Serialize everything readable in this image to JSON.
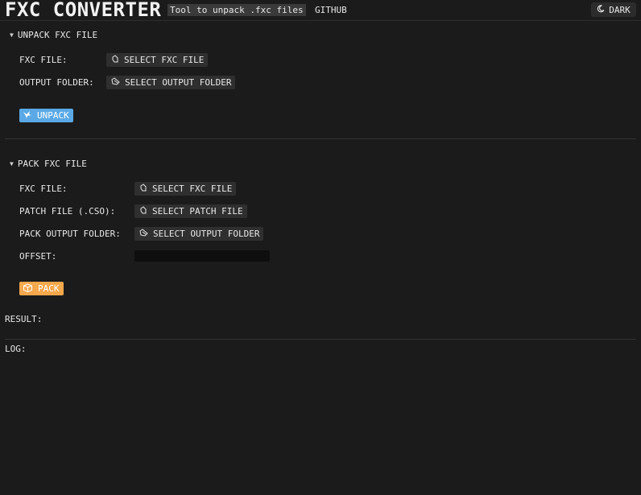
{
  "header": {
    "title": "FXC CONVERTER",
    "subtitle": "Tool to unpack .fxc files",
    "github_label": "GITHUB",
    "theme_label": "DARK"
  },
  "unpack_section": {
    "title": "UNPACK FXC FILE",
    "fxc_label": "FXC FILE:",
    "fxc_button": "SELECT FXC FILE",
    "output_label": "OUTPUT FOLDER:",
    "output_button": "SELECT OUTPUT FOLDER",
    "action_label": "UNPACK"
  },
  "pack_section": {
    "title": "PACK FXC FILE",
    "fxc_label": "FXC FILE:",
    "fxc_button": "SELECT FXC FILE",
    "patch_label": "PATCH FILE (.CSO):",
    "patch_button": "SELECT PATCH FILE",
    "output_label": "PACK OUTPUT FOLDER:",
    "output_button": "SELECT OUTPUT FOLDER",
    "offset_label": "OFFSET:",
    "offset_value": "",
    "action_label": "PACK"
  },
  "result_label": "RESULT:",
  "log_label": "LOG:",
  "colors": {
    "background": "#1b1b1b",
    "unpack_accent": "#5aa9e6",
    "pack_accent": "#f5a84c"
  },
  "icons": {
    "theme": "moon-icon",
    "file": "file-icon",
    "folder": "folder-icon",
    "unpack": "bird-icon",
    "pack": "box-icon"
  }
}
